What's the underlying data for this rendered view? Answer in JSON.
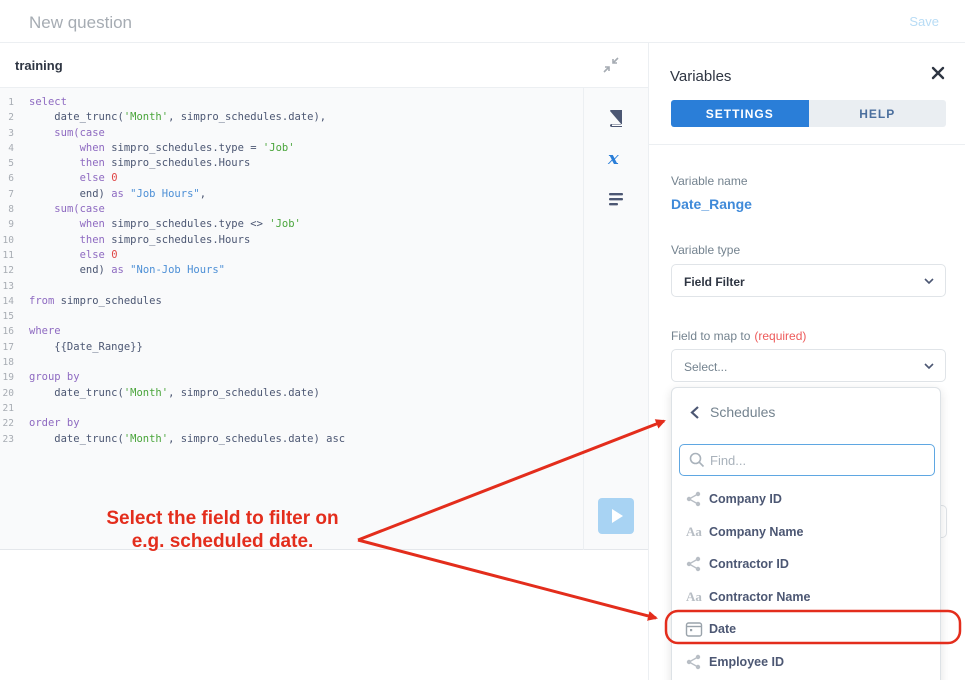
{
  "header": {
    "title": "New question",
    "save_label": "Save"
  },
  "editor": {
    "database": "training",
    "code_lines": [
      [
        [
          "kw",
          "select"
        ]
      ],
      [
        [
          "t",
          "    date_trunc("
        ],
        [
          "str",
          "'Month'"
        ],
        [
          "t",
          ", simpro_schedules.date),"
        ]
      ],
      [
        [
          "t",
          "    "
        ],
        [
          "kw",
          "sum(case"
        ]
      ],
      [
        [
          "t",
          "        "
        ],
        [
          "kw",
          "when"
        ],
        [
          "t",
          " simpro_schedules.type = "
        ],
        [
          "str",
          "'Job'"
        ]
      ],
      [
        [
          "t",
          "        "
        ],
        [
          "kw",
          "then"
        ],
        [
          "t",
          " simpro_schedules.Hours"
        ]
      ],
      [
        [
          "t",
          "        "
        ],
        [
          "kw",
          "else"
        ],
        [
          "t",
          " "
        ],
        [
          "num",
          "0"
        ]
      ],
      [
        [
          "t",
          "        end) "
        ],
        [
          "kw",
          "as"
        ],
        [
          "t",
          " "
        ],
        [
          "var",
          "\"Job Hours\""
        ],
        [
          "t",
          ","
        ]
      ],
      [
        [
          "t",
          "    "
        ],
        [
          "kw",
          "sum(case"
        ]
      ],
      [
        [
          "t",
          "        "
        ],
        [
          "kw",
          "when"
        ],
        [
          "t",
          " simpro_schedules.type <> "
        ],
        [
          "str",
          "'Job'"
        ]
      ],
      [
        [
          "t",
          "        "
        ],
        [
          "kw",
          "then"
        ],
        [
          "t",
          " simpro_schedules.Hours"
        ]
      ],
      [
        [
          "t",
          "        "
        ],
        [
          "kw",
          "else"
        ],
        [
          "t",
          " "
        ],
        [
          "num",
          "0"
        ]
      ],
      [
        [
          "t",
          "        end) "
        ],
        [
          "kw",
          "as"
        ],
        [
          "t",
          " "
        ],
        [
          "var",
          "\"Non-Job Hours\""
        ]
      ],
      [],
      [
        [
          "kw",
          "from"
        ],
        [
          "t",
          " simpro_schedules"
        ]
      ],
      [],
      [
        [
          "kw",
          "where"
        ]
      ],
      [
        [
          "t",
          "    {{Date_Range}}"
        ]
      ],
      [],
      [
        [
          "kw",
          "group by"
        ]
      ],
      [
        [
          "t",
          "    date_trunc("
        ],
        [
          "str",
          "'Month'"
        ],
        [
          "t",
          ", simpro_schedules.date)"
        ]
      ],
      [],
      [
        [
          "kw",
          "order by"
        ]
      ],
      [
        [
          "t",
          "    date_trunc("
        ],
        [
          "str",
          "'Month'"
        ],
        [
          "t",
          ", simpro_schedules.date) asc"
        ]
      ]
    ]
  },
  "sidebar": {
    "title": "Variables",
    "tabs": [
      {
        "label": "SETTINGS"
      },
      {
        "label": "HELP"
      }
    ],
    "variable_name_label": "Variable name",
    "variable_name_value": "Date_Range",
    "variable_type_label": "Variable type",
    "variable_type_value": "Field Filter",
    "field_map_label": "Field to map to",
    "field_map_required": "(required)",
    "field_map_value": "Select..."
  },
  "dropdown": {
    "back_title": "Schedules",
    "find_placeholder": "Find...",
    "fields": [
      {
        "label": "Company ID",
        "icon": "connections-icon"
      },
      {
        "label": "Company Name",
        "icon": "string-icon"
      },
      {
        "label": "Contractor ID",
        "icon": "connections-icon"
      },
      {
        "label": "Contractor Name",
        "icon": "string-icon"
      },
      {
        "label": "Date",
        "icon": "calendar-icon"
      },
      {
        "label": "Employee ID",
        "icon": "connections-icon"
      }
    ]
  },
  "annotation": {
    "line1": "Select the field to filter on",
    "line2": "e.g. scheduled date.",
    "color": "#e32d1c"
  },
  "colors": {
    "brand": "#2a7ed8",
    "run_button": "#a8d3f3",
    "find_border": "#5fa7e2"
  }
}
